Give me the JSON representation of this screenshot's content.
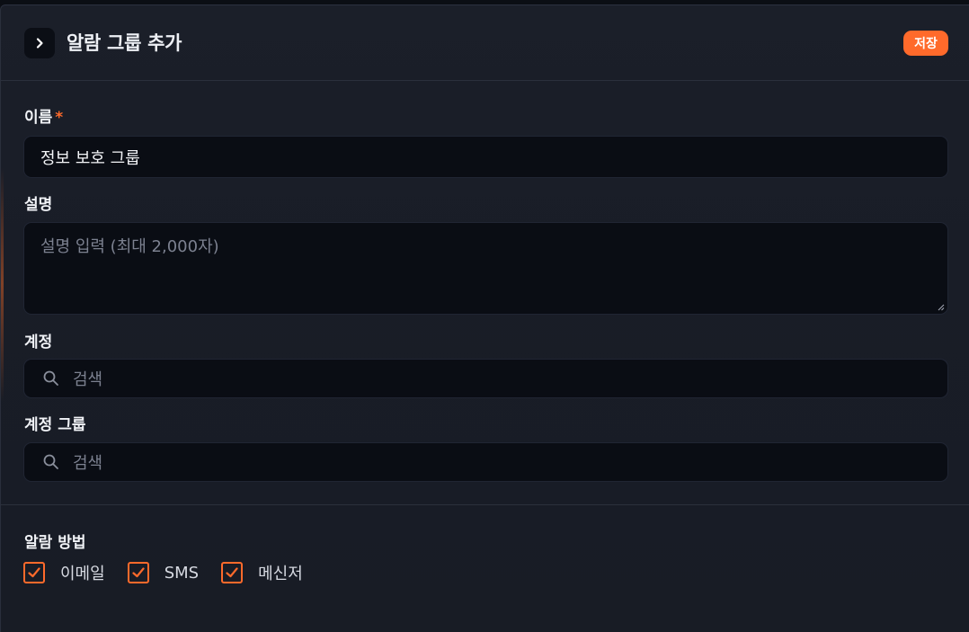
{
  "header": {
    "title": "알람 그룹 추가",
    "save_label": "저장"
  },
  "form": {
    "name": {
      "label": "이름",
      "required_mark": "*",
      "value": "정보 보호 그룹"
    },
    "description": {
      "label": "설명",
      "placeholder": "설명 입력 (최대 2,000자)"
    },
    "account": {
      "label": "계정",
      "placeholder": "검색"
    },
    "account_group": {
      "label": "계정 그룹",
      "placeholder": "검색"
    }
  },
  "notify": {
    "label": "알람 방법",
    "options": [
      {
        "label": "이메일",
        "checked": true
      },
      {
        "label": "SMS",
        "checked": true
      },
      {
        "label": "메신저",
        "checked": true
      }
    ]
  },
  "colors": {
    "accent": "#ff6a2b",
    "panel": "#1b1f29",
    "input": "#0a0d14"
  },
  "icons": {
    "toggle": "chevron-right-icon",
    "search": "search-icon",
    "check": "check-icon"
  }
}
